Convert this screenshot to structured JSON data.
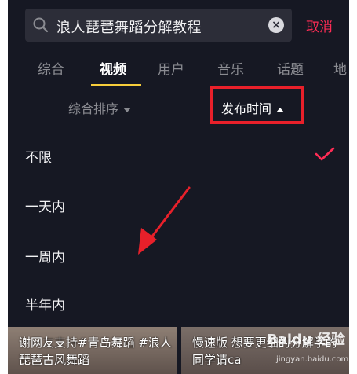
{
  "search": {
    "query": "浪人琵琶舞蹈分解教程",
    "cancel_label": "取消"
  },
  "tabs": [
    {
      "label": "综合"
    },
    {
      "label": "视频"
    },
    {
      "label": "用户"
    },
    {
      "label": "音乐"
    },
    {
      "label": "话题"
    },
    {
      "label": "地"
    }
  ],
  "active_tab": "视频",
  "filters": {
    "sort_label": "综合排序",
    "time_label": "发布时间"
  },
  "time_options": [
    {
      "label": "不限",
      "selected": true
    },
    {
      "label": "一天内"
    },
    {
      "label": "一周内"
    },
    {
      "label": "半年内"
    }
  ],
  "cards": [
    {
      "caption": "谢网友支持#青岛舞蹈 #浪人琵琶古风舞蹈"
    },
    {
      "caption": "慢速版 想要更细的分解学的同学请ca"
    }
  ],
  "watermark": {
    "brand": "Baidu 经验",
    "url": "jingyan.baidu.com"
  },
  "colors": {
    "background": "#161823",
    "accent": "#fe2c55",
    "tab_indicator": "#f7cd3b",
    "annotation": "#e8202a"
  }
}
